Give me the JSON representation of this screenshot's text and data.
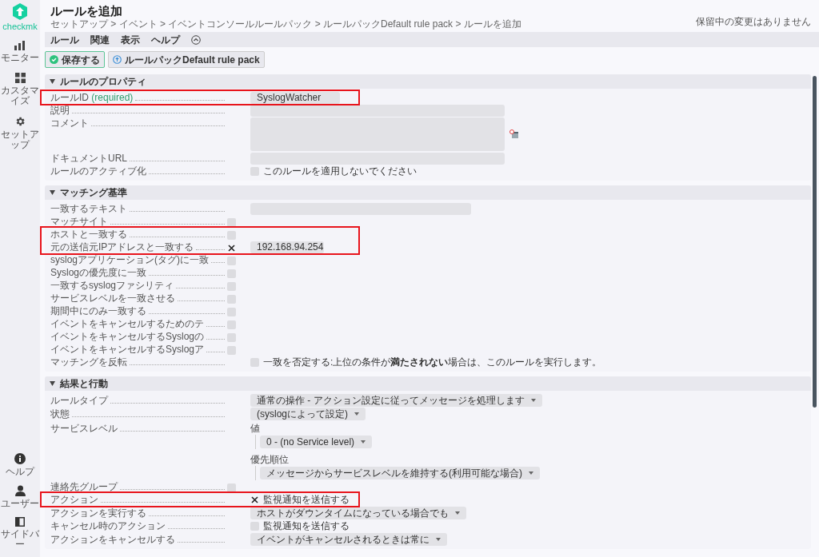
{
  "sidebar": {
    "logo": "checkmk",
    "top_items": [
      {
        "label": "モニター"
      },
      {
        "label": "カスタマイズ"
      },
      {
        "label": "セットアップ"
      }
    ],
    "bottom_items": [
      {
        "label": "ヘルプ"
      },
      {
        "label": "ユーザー"
      },
      {
        "label": "サイドバー"
      }
    ]
  },
  "header": {
    "title": "ルールを追加",
    "breadcrumb": "セットアップ > イベント > イベントコンソールルールパック > ルールパックDefault rule pack > ルールを追加",
    "pending": "保留中の変更はありません"
  },
  "menu": [
    "ルール",
    "関連",
    "表示",
    "ヘルプ"
  ],
  "buttons": [
    {
      "label": "保存する",
      "kind": "primary"
    },
    {
      "label": "ルールパックDefault rule pack",
      "kind": "secondary"
    }
  ],
  "sections": [
    {
      "title": "ルールのプロパティ",
      "expanded": true,
      "rows": [
        {
          "label": "ルールID",
          "required": "(required)",
          "kind": "text",
          "value": "SyslogWatcher",
          "highlighted": true
        },
        {
          "label": "説明",
          "kind": "text",
          "highlighted": false
        },
        {
          "label": "コメント",
          "kind": "textarea",
          "highlighted": false
        },
        {
          "label": "ドキュメントURL",
          "kind": "text",
          "highlighted": false
        },
        {
          "label": "ルールのアクティブ化",
          "kind": "checkbox",
          "checked": false,
          "option": "このルールを適用しないでください",
          "highlighted": false
        }
      ]
    },
    {
      "title": "マッチング基準",
      "expanded": true,
      "rows": [
        {
          "label": "一致するテキスト",
          "kind": "text",
          "highlighted": false
        },
        {
          "label": "マッチサイト",
          "kind": "optional",
          "checked": false,
          "highlighted": false
        },
        {
          "label": "ホストと一致する",
          "kind": "optional",
          "checked": false,
          "highlighted": true
        },
        {
          "label": "元の送信元IPアドレスと一致する",
          "kind": "optional",
          "checked": true,
          "value": "192.168.94.254",
          "highlighted": true
        },
        {
          "label": "syslogアプリケーション(タグ)に一致",
          "kind": "optional",
          "checked": false,
          "highlighted": false
        },
        {
          "label": "Syslogの優先度に一致",
          "kind": "optional",
          "checked": false,
          "highlighted": false
        },
        {
          "label": "一致するsyslogファシリティ",
          "kind": "optional",
          "checked": false,
          "highlighted": false
        },
        {
          "label": "サービスレベルを一致させる",
          "kind": "optional",
          "checked": false,
          "highlighted": false
        },
        {
          "label": "期間中にのみ一致する",
          "kind": "optional",
          "checked": false,
          "highlighted": false
        },
        {
          "label": "イベントをキャンセルするためのテ",
          "kind": "optional",
          "checked": false,
          "highlighted": false
        },
        {
          "label": "イベントをキャンセルするSyslogの",
          "kind": "optional",
          "checked": false,
          "highlighted": false
        },
        {
          "label": "イベントをキャンセルするSyslogア",
          "kind": "optional",
          "checked": false,
          "highlighted": false
        },
        {
          "label": "マッチングを反転",
          "kind": "checkbox",
          "checked": false,
          "option": "一致を否定する:上位の条件が**満たされない**場合は、このルールを実行します。",
          "highlighted": false
        }
      ]
    },
    {
      "title": "結果と行動",
      "expanded": true,
      "rows": [
        {
          "label": "ルールタイプ",
          "kind": "select",
          "value": "通常の操作 - アクション設定に従ってメッセージを処理します",
          "highlighted": false
        },
        {
          "label": "状態",
          "kind": "select",
          "value": "(syslogによって設定)",
          "highlighted": false
        },
        {
          "label": "サービスレベル",
          "kind": "group",
          "fields": [
            {
              "label": "値",
              "value": "0 - (no Service level)"
            },
            {
              "label": "優先順位",
              "value": "メッセージからサービスレベルを維持する(利用可能な場合)"
            }
          ],
          "highlighted": false
        },
        {
          "label": "連絡先グループ",
          "kind": "optional",
          "checked": false,
          "highlighted": false
        },
        {
          "label": "アクション",
          "kind": "checkbox",
          "checked": true,
          "option": "監視通知を送信する",
          "highlighted": true
        },
        {
          "label": "アクションを実行する",
          "kind": "select",
          "value": "ホストがダウンタイムになっている場合でも",
          "highlighted": false
        },
        {
          "label": "キャンセル時のアクション",
          "kind": "checkbox",
          "checked": false,
          "option": "監視通知を送信する",
          "highlighted": false
        },
        {
          "label": "アクションをキャンセルする",
          "kind": "select",
          "value": "イベントがキャンセルされるときは常に",
          "highlighted": false
        }
      ]
    }
  ]
}
